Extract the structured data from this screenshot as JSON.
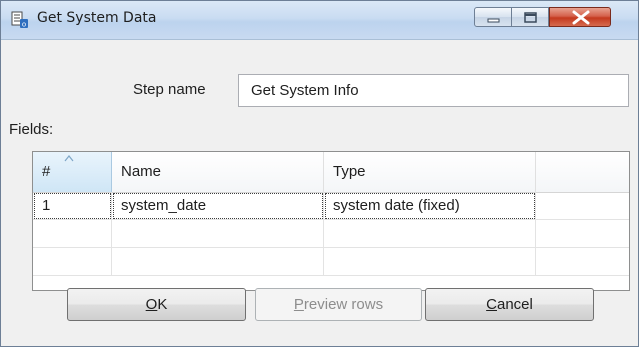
{
  "window": {
    "title": "Get System Data",
    "icon": "table-step-icon",
    "controls": [
      "minimize-icon",
      "maximize-icon",
      "close-icon"
    ]
  },
  "form": {
    "step_name_label": "Step name",
    "step_name_value": "Get System Info",
    "fields_label": "Fields:"
  },
  "table": {
    "columns": [
      "#",
      "Name",
      "Type",
      ""
    ],
    "sort_indicator": "sort-ascending-icon",
    "rows": [
      [
        "1",
        "system_date",
        "system date (fixed)",
        ""
      ],
      [
        "",
        "",
        "",
        ""
      ],
      [
        "",
        "",
        "",
        ""
      ]
    ]
  },
  "buttons": {
    "ok": {
      "mnemonic": "O",
      "rest": "K"
    },
    "preview": {
      "mnemonic": "P",
      "rest": "review rows",
      "disabled": true
    },
    "cancel": {
      "mnemonic": "C",
      "rest": "ancel"
    }
  },
  "colors": {
    "titlebar": "#c9dcf2",
    "close_button": "#c4391e",
    "selected_header": "#cfe6f6"
  }
}
